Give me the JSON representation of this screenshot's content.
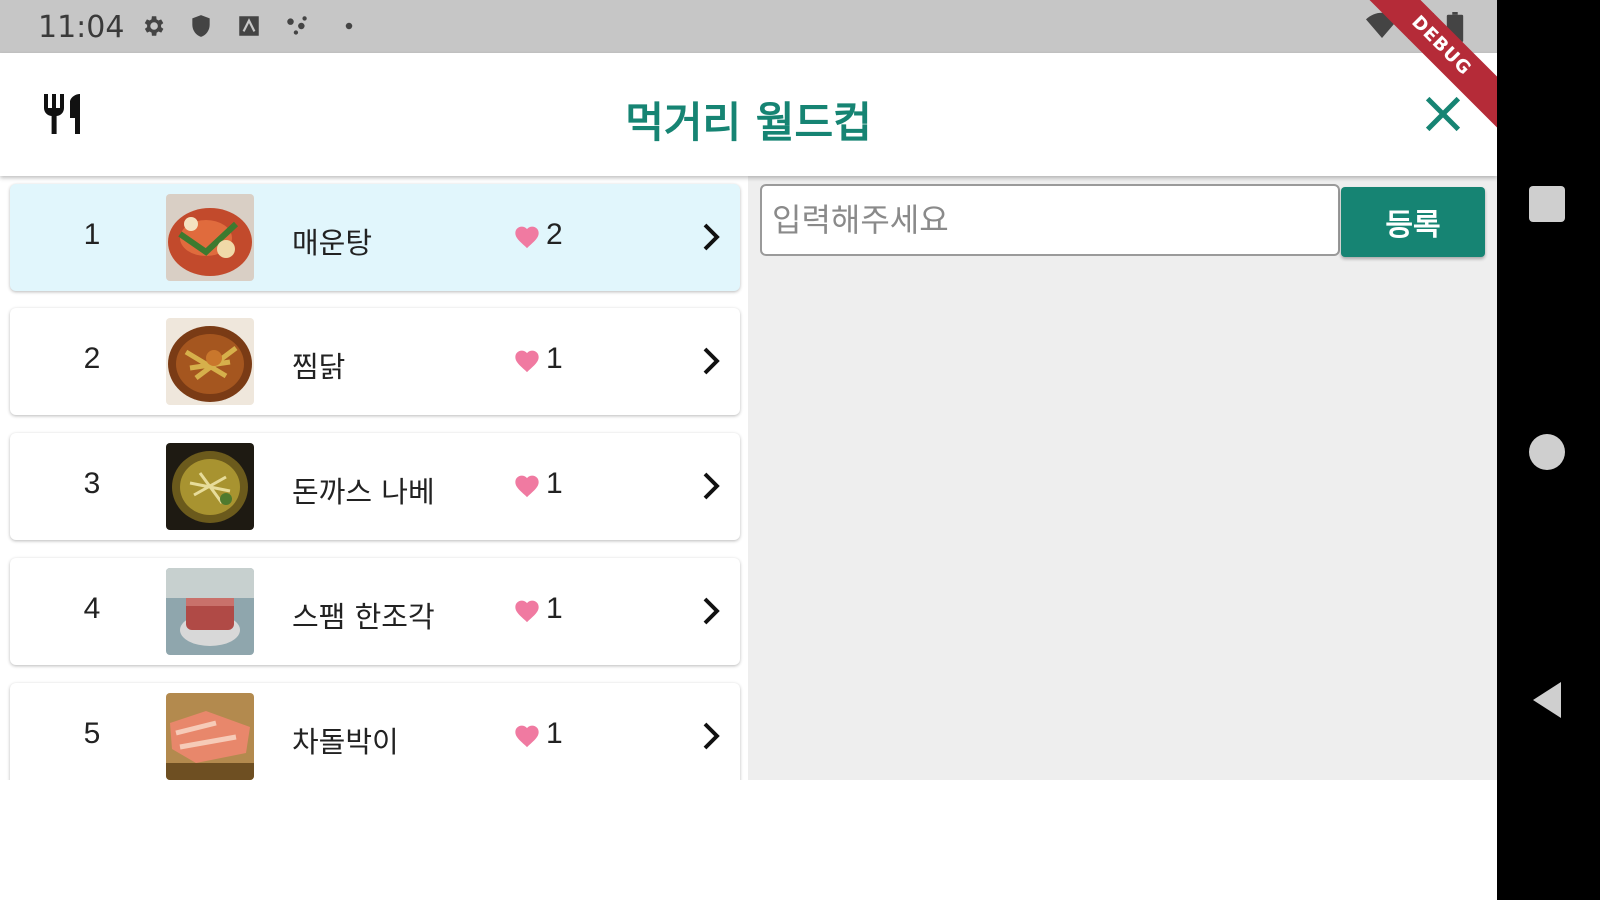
{
  "status_bar": {
    "time": "11:04",
    "left_icons": [
      "settings-icon",
      "shield-icon",
      "storage-icon",
      "network-icon",
      "dot-icon"
    ],
    "right_icons": [
      "wifi-icon",
      "signal-icon",
      "battery-icon"
    ]
  },
  "app_bar": {
    "title": "먹거리 월드컵",
    "leading_icon": "restaurant-icon",
    "close_icon": "close-icon"
  },
  "debug_banner": "DEBUG",
  "list": {
    "items": [
      {
        "rank": "1",
        "name": "매운탕",
        "likes": "2",
        "selected": true
      },
      {
        "rank": "2",
        "name": "찜닭",
        "likes": "1",
        "selected": false
      },
      {
        "rank": "3",
        "name": "돈까스 나베",
        "likes": "1",
        "selected": false
      },
      {
        "rank": "4",
        "name": "스팸 한조각",
        "likes": "1",
        "selected": false
      },
      {
        "rank": "5",
        "name": "차돌박이",
        "likes": "1",
        "selected": false
      }
    ]
  },
  "form": {
    "input_value": "",
    "input_placeholder": "입력해주세요",
    "submit_label": "등록"
  },
  "colors": {
    "accent": "#168473",
    "selected_row": "#e1f6fc",
    "heart": "#f07aa1",
    "status_bar": "#c6c6c6",
    "pane_bg": "#eeeeee",
    "debug_banner": "#b52b38"
  },
  "nav_bar": [
    "recents-icon",
    "home-icon",
    "back-icon"
  ]
}
